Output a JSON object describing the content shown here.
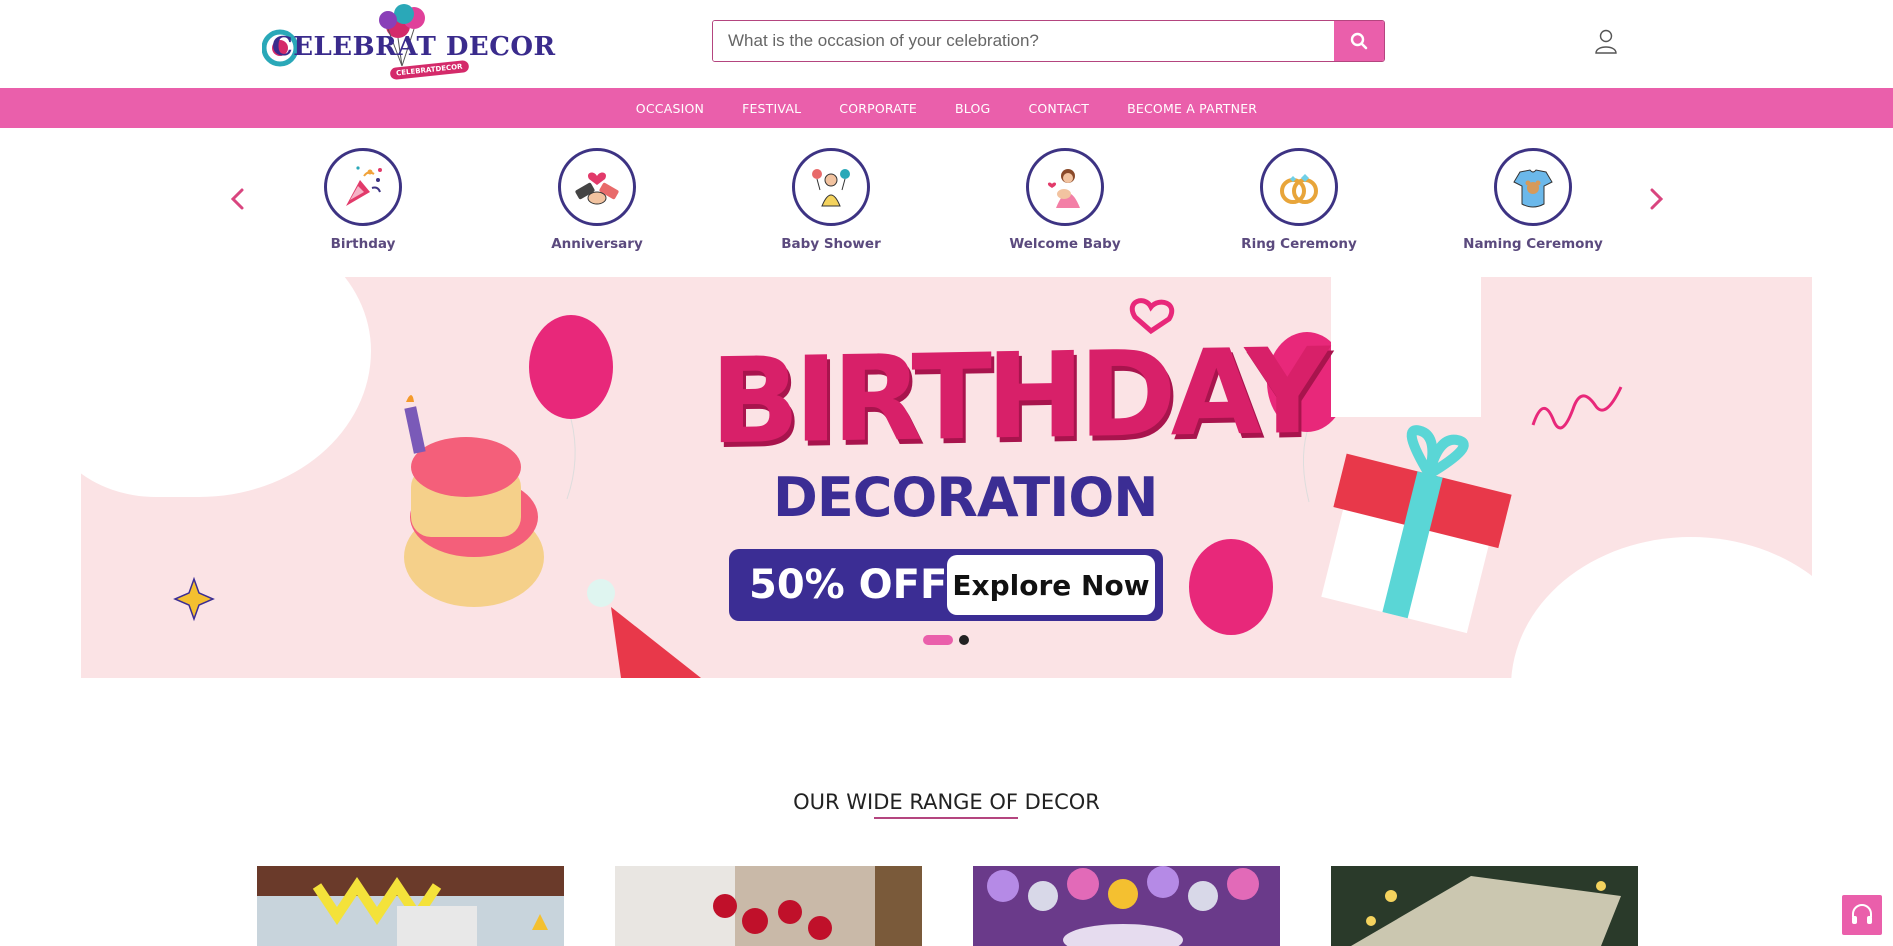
{
  "header": {
    "logo_text": "CELEBRAT DECOR",
    "logo_subtext": "CELEBRATDECOR",
    "search": {
      "placeholder": "What is the occasion of your celebration?",
      "value": ""
    }
  },
  "nav": {
    "items": [
      "OCCASION",
      "FESTIVAL",
      "CORPORATE",
      "BLOG",
      "CONTACT",
      "BECOME A PARTNER"
    ]
  },
  "categories": [
    {
      "label": "Birthday",
      "icon": "party-popper-icon"
    },
    {
      "label": "Anniversary",
      "icon": "handshake-heart-icon"
    },
    {
      "label": "Baby Shower",
      "icon": "baby-shower-icon"
    },
    {
      "label": "Welcome Baby",
      "icon": "mother-baby-icon"
    },
    {
      "label": "Ring Ceremony",
      "icon": "rings-icon"
    },
    {
      "label": "Naming Ceremony",
      "icon": "baby-onesie-icon"
    }
  ],
  "banner": {
    "title": "BIRTHDAY",
    "subtitle": "DECORATION",
    "offer": "50% OFF",
    "cta": "Explore Now",
    "slide_count": 2,
    "active_slide": 1
  },
  "section": {
    "title": "OUR WIDE RANGE OF DECOR"
  },
  "colors": {
    "brand_pink": "#ea5fab",
    "brand_purple": "#3b2d94",
    "banner_bg": "#fbe3e5",
    "banner_title": "#d82069"
  }
}
